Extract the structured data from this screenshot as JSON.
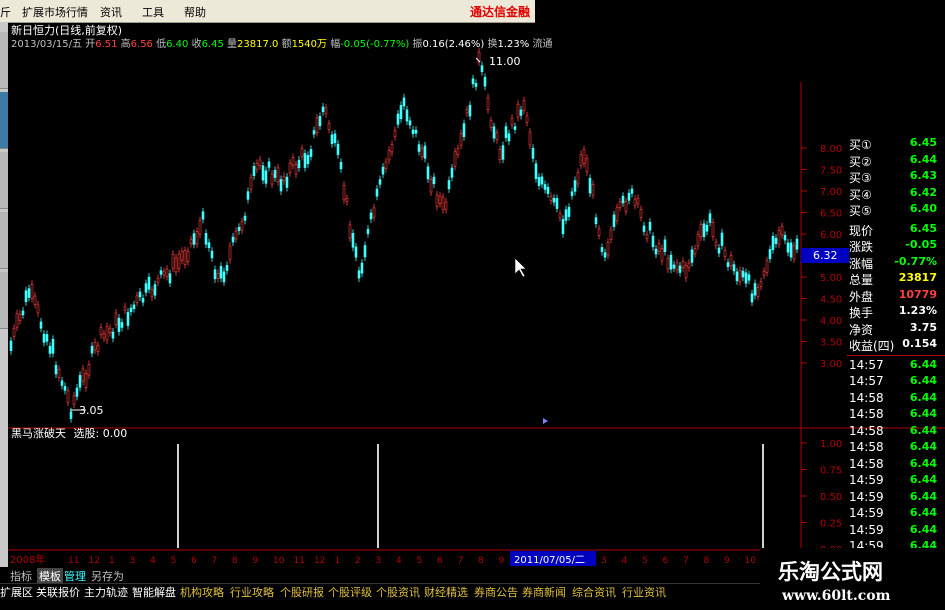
{
  "menu": [
    "扩展市场行情",
    "资讯",
    "工具",
    "帮助"
  ],
  "broker": "通达信金融",
  "chart_title": "新日恒力(日线,前复权)",
  "info_line": {
    "date": "2013/03/15/五",
    "open_label": "开",
    "open": "6.51",
    "high_label": "高",
    "high": "6.56",
    "low_label": "低",
    "low": "6.40",
    "close_label": "收",
    "close": "6.45",
    "vol_label": "量",
    "vol": "23817.0",
    "amt_label": "额",
    "amt": "1540万",
    "chg_label": "幅",
    "chg": "-0.05(-0.77%)",
    "amp_label": "振",
    "amp": "0.16(2.46%)",
    "turn_label": "换",
    "turn": "1.23%",
    "flow_label": "流通"
  },
  "price_axis": [
    "8.00",
    "7.50",
    "7.00",
    "6.50",
    "6.00",
    "5.50",
    "5.00",
    "4.50",
    "4.00",
    "3.50",
    "3.00"
  ],
  "indicator_axis": [
    "1.00",
    "0.75",
    "0.50",
    "0.25",
    "0.00"
  ],
  "peak_label": "11.00",
  "trough_label": "3.05",
  "last_price_tag": "6.32",
  "indicator_title": "黑马涨破天",
  "indicator_value_label": "选股:",
  "indicator_value": "0.00",
  "quote": {
    "bids": [
      {
        "label": "买①",
        "price": "6.45"
      },
      {
        "label": "买②",
        "price": "6.44"
      },
      {
        "label": "买③",
        "price": "6.43"
      },
      {
        "label": "买④",
        "price": "6.42"
      },
      {
        "label": "买⑤",
        "price": "6.40"
      }
    ],
    "fields": [
      {
        "label": "现价",
        "value": "6.45"
      },
      {
        "label": "涨跌",
        "value": "-0.05"
      },
      {
        "label": "涨幅",
        "value": "-0.77%"
      },
      {
        "label": "总量",
        "value": "23817"
      },
      {
        "label": "外盘",
        "value": "10779"
      },
      {
        "label": "换手",
        "value": "1.23%"
      },
      {
        "label": "净资",
        "value": "3.75"
      },
      {
        "label": "收益(四)",
        "value": "0.154"
      }
    ],
    "ticks": [
      {
        "time": "14:57",
        "price": "6.44"
      },
      {
        "time": "14:57",
        "price": "6.44"
      },
      {
        "time": "14:58",
        "price": "6.44"
      },
      {
        "time": "14:58",
        "price": "6.44"
      },
      {
        "time": "14:58",
        "price": "6.44"
      },
      {
        "time": "14:58",
        "price": "6.44"
      },
      {
        "time": "14:58",
        "price": "6.44"
      },
      {
        "time": "14:59",
        "price": "6.44"
      },
      {
        "time": "14:59",
        "price": "6.44"
      },
      {
        "time": "14:59",
        "price": "6.44"
      },
      {
        "time": "14:59",
        "price": "6.44"
      },
      {
        "time": "14:59",
        "price": "6.44"
      }
    ]
  },
  "date_axis": {
    "year": "2008年",
    "cursor_date": "2011/07/05/二"
  },
  "bottom_tabs": [
    "指标",
    "模板",
    "管理",
    "另存为"
  ],
  "bottom_buttons": [
    "扩展区",
    "关联报价",
    "主力轨迹",
    "智能解盘",
    "机构攻略",
    "行业攻略",
    "个股研报",
    "个股评级",
    "个股资讯",
    "财经精选",
    "券商公告",
    "券商新闻",
    "综合资讯",
    "行业资讯"
  ],
  "watermark": {
    "title": "乐淘公式网",
    "url": "www.60lt.com"
  },
  "colors": {
    "up": "#ff4040",
    "down": "#40ffff",
    "axis": "#b00000",
    "white": "#ffffff",
    "yellow": "#ffff00",
    "green": "#00ff00"
  }
}
